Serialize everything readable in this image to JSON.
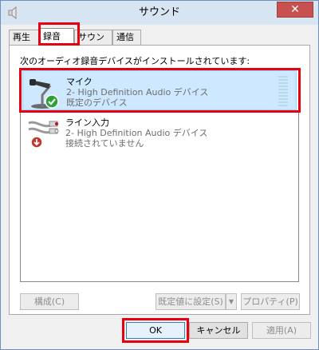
{
  "window": {
    "title": "サウンド",
    "close_symbol": "✕"
  },
  "tabs": [
    {
      "label": "再生"
    },
    {
      "label": "録音"
    },
    {
      "label": "サウンド"
    },
    {
      "label": "通信"
    }
  ],
  "recording": {
    "description": "次のオーディオ録音デバイスがインストールされています:",
    "devices": [
      {
        "name": "マイク",
        "driver": "2- High Definition Audio デバイス",
        "status": "既定のデバイス",
        "icon": "microphone-icon"
      },
      {
        "name": "ライン入力",
        "driver": "2- High Definition Audio デバイス",
        "status": "接続されていません",
        "icon": "line-in-icon"
      }
    ]
  },
  "panel_buttons": {
    "configure": "構成(C)",
    "set_default": "既定値に設定(S)",
    "set_default_arrow": "▼",
    "properties": "プロパティ(P)"
  },
  "dialog_buttons": {
    "ok": "OK",
    "cancel": "キャンセル",
    "apply": "適用(A)"
  },
  "colors": {
    "highlight": "#e60012",
    "selection": "#cde8ff",
    "accent": "#3c7fb1"
  }
}
